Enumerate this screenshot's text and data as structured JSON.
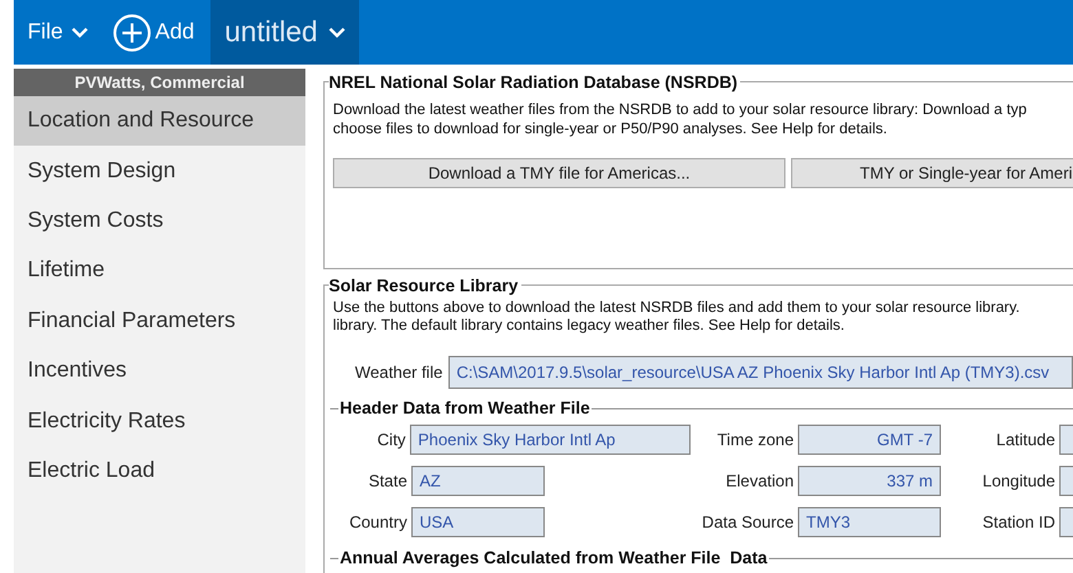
{
  "toolbar": {
    "file_menu": "File",
    "add_button": "Add",
    "case_tab": {
      "label": "untitled",
      "selected": true
    }
  },
  "sidebar": {
    "header": "PVWatts, Commercial",
    "items": [
      {
        "label": "Location and Resource",
        "selected": true
      },
      {
        "label": "System Design",
        "selected": false
      },
      {
        "label": "System Costs",
        "selected": false
      },
      {
        "label": "Lifetime",
        "selected": false
      },
      {
        "label": "Financial Parameters",
        "selected": false
      },
      {
        "label": "Incentives",
        "selected": false
      },
      {
        "label": "Electricity Rates",
        "selected": false
      },
      {
        "label": "Electric Load",
        "selected": false
      }
    ]
  },
  "nsrdb": {
    "title": "NREL National Solar Radiation Database (NSRDB)",
    "description": [
      "Download the latest weather files from the NSRDB to add to your solar resource library: Download a typ",
      "choose files to download for single-year or P50/P90 analyses. See Help for details."
    ],
    "buttons": [
      "Download a TMY file for Americas...",
      "TMY or Single-year for Ameri"
    ]
  },
  "library": {
    "title": "Solar Resource Library",
    "description": [
      "Use the buttons above to download the latest NSRDB files and add them to your solar resource library.",
      "library. The default library contains legacy weather files. See Help for details."
    ],
    "weather_file": {
      "label": "Weather file",
      "value": "C:\\SAM\\2017.9.5\\solar_resource\\USA AZ Phoenix Sky Harbor Intl Ap (TMY3).csv"
    }
  },
  "header_data": {
    "title": "Header Data from Weather File",
    "rows": [
      [
        {
          "label": "City",
          "value": "Phoenix Sky Harbor Intl Ap"
        },
        {
          "label": "Time zone",
          "value": "GMT -7"
        },
        {
          "label": "Latitude"
        }
      ],
      [
        {
          "label": "State",
          "value": "AZ"
        },
        {
          "label": "Elevation",
          "value": "337 m"
        },
        {
          "label": "Longitude"
        }
      ],
      [
        {
          "label": "Country",
          "value": "USA"
        },
        {
          "label": "Data Source",
          "value": "TMY3"
        },
        {
          "label": "Station ID"
        }
      ]
    ]
  },
  "annual_averages": {
    "title": "Annual Averages Calculated from Weather File  Data"
  }
}
